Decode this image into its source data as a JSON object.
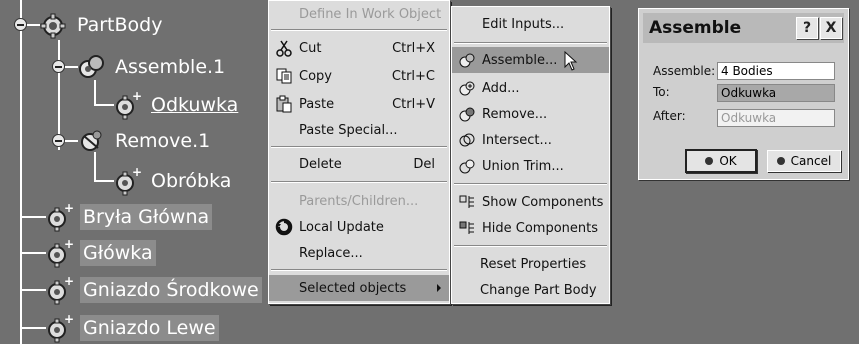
{
  "tree": {
    "root": "PartBody",
    "nodes": [
      {
        "label": "Assemble.1"
      },
      {
        "label": "Odkuwka"
      },
      {
        "label": "Remove.1"
      },
      {
        "label": "Obróbka"
      },
      {
        "label": "Bryła Główna"
      },
      {
        "label": "Główka"
      },
      {
        "label": "Gniazdo Środkowe"
      },
      {
        "label": "Gniazdo Lewe"
      }
    ]
  },
  "context_menu": {
    "items": [
      {
        "label": "Define In Work Object",
        "shortcut": ""
      },
      {
        "label": "Cut",
        "shortcut": "Ctrl+X"
      },
      {
        "label": "Copy",
        "shortcut": "Ctrl+C"
      },
      {
        "label": "Paste",
        "shortcut": "Ctrl+V"
      },
      {
        "label": "Paste Special...",
        "shortcut": ""
      },
      {
        "label": "Delete",
        "shortcut": "Del"
      },
      {
        "label": "Parents/Children...",
        "shortcut": ""
      },
      {
        "label": "Local Update",
        "shortcut": ""
      },
      {
        "label": "Replace...",
        "shortcut": ""
      },
      {
        "label": "Selected objects",
        "shortcut": ""
      }
    ]
  },
  "submenu": {
    "items": [
      {
        "label": "Edit Inputs..."
      },
      {
        "label": "Assemble..."
      },
      {
        "label": "Add..."
      },
      {
        "label": "Remove..."
      },
      {
        "label": "Intersect..."
      },
      {
        "label": "Union Trim..."
      },
      {
        "label": "Show Components"
      },
      {
        "label": "Hide Components"
      },
      {
        "label": "Reset Properties"
      },
      {
        "label": "Change Part Body"
      }
    ]
  },
  "dialog": {
    "title": "Assemble",
    "help": "?",
    "close": "X",
    "assemble_label": "Assemble:",
    "assemble_value": "4 Bodies",
    "to_label": "To:",
    "to_value": "Odkuwka",
    "after_label": "After:",
    "after_value": "Odkuwka",
    "ok_label": "OK",
    "cancel_label": "Cancel"
  },
  "colors": {
    "menu_bg": "#dcdcdc",
    "highlight": "#9a9a9a",
    "background": "#707070"
  }
}
